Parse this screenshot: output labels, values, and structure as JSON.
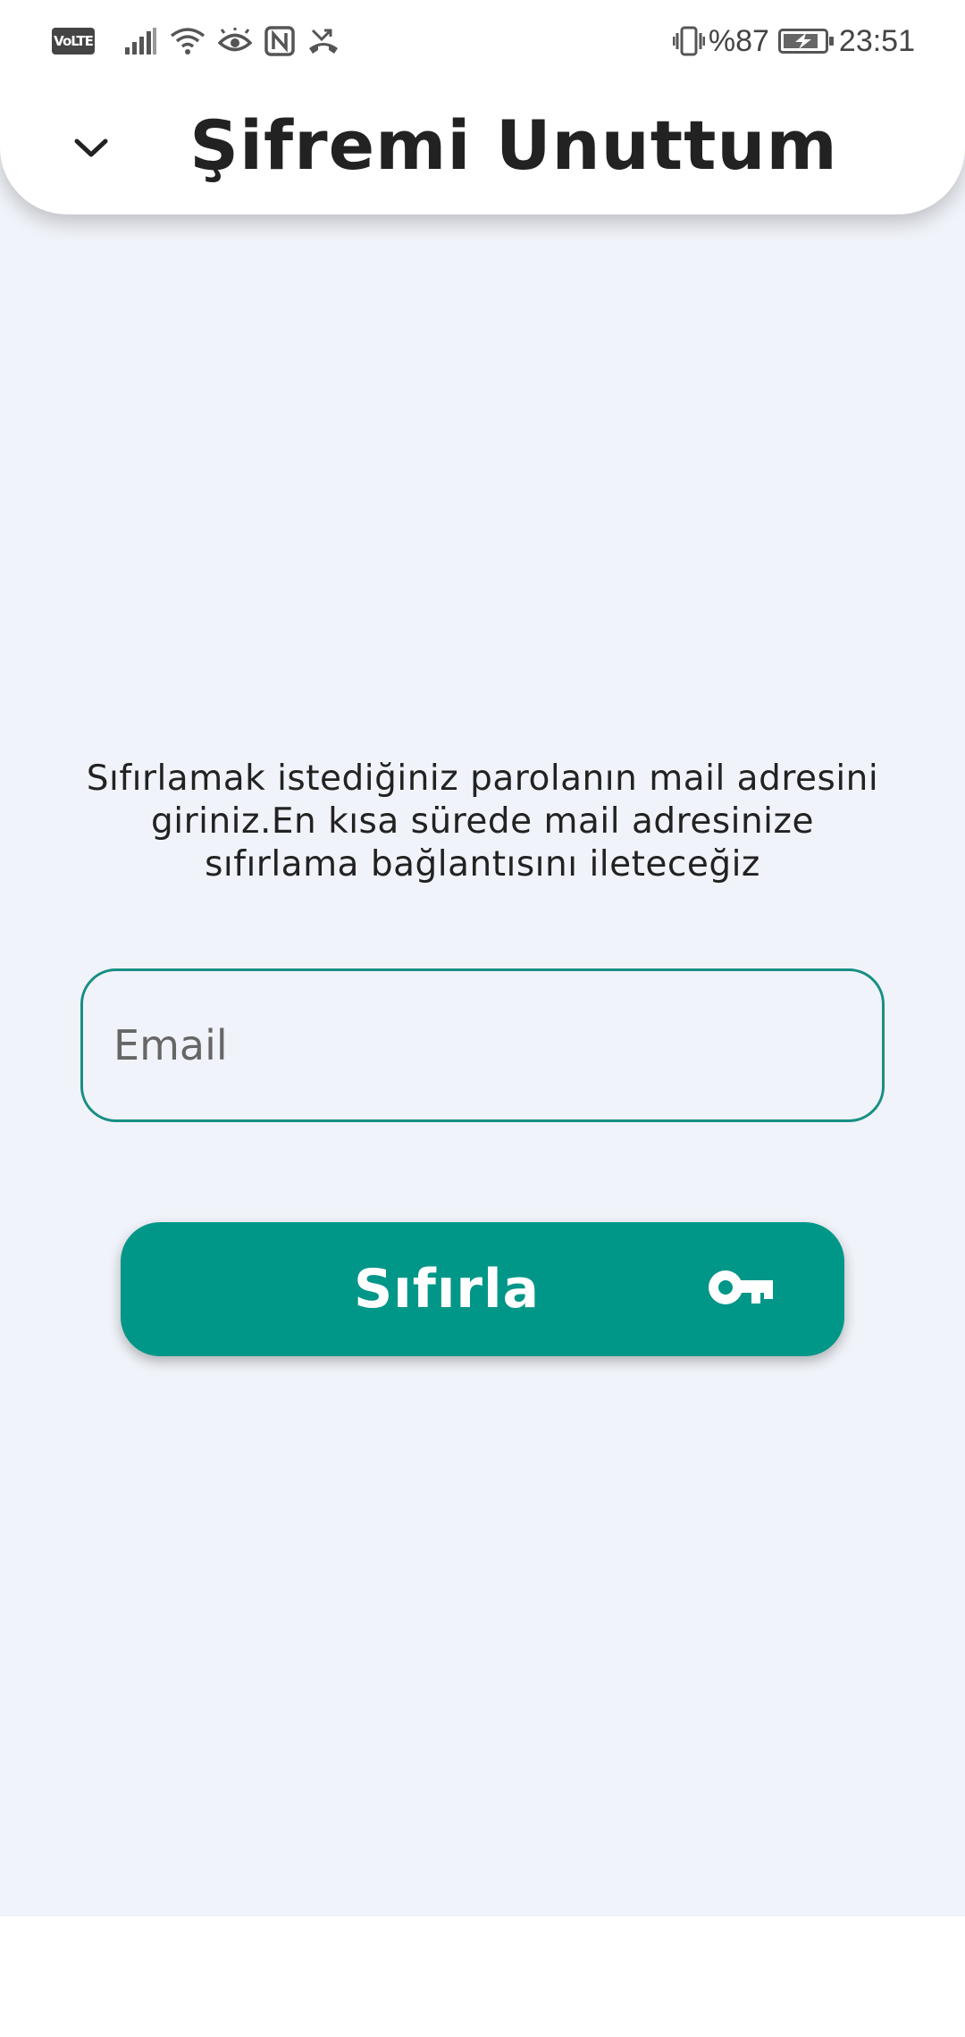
{
  "status_bar": {
    "network_badge": "VoLTE",
    "battery_percent": "%87",
    "battery_level": 0.87,
    "time": "23:51",
    "icons": [
      "signal-icon",
      "wifi-icon",
      "eye-icon",
      "nfc-icon",
      "missed-call-icon",
      "vibrate-icon",
      "battery-icon"
    ]
  },
  "header": {
    "title": "Şifremi Unuttum",
    "back_icon": "chevron-down-icon"
  },
  "main": {
    "instruction": "Sıfırlamak istediğiniz parolanın mail adresini giriniz.En kısa sürede mail adresinize sıfırlama bağlantısını ileteceğiz",
    "email_placeholder": "Email",
    "email_value": "",
    "reset_button_label": "Sıfırla",
    "reset_button_icon": "key-icon"
  },
  "colors": {
    "accent": "#009688",
    "field_border": "#178f83",
    "background": "#f0f3f9"
  }
}
